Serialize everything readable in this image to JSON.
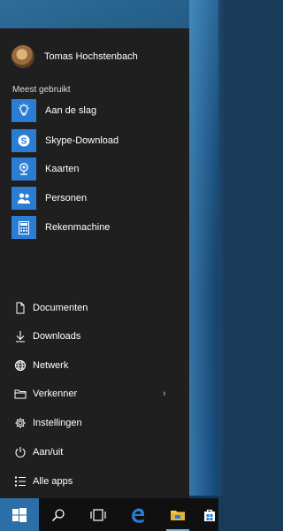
{
  "user": {
    "name": "Tomas Hochstenbach"
  },
  "most_used": {
    "heading": "Meest gebruikt",
    "apps": [
      {
        "label": "Aan de slag",
        "icon": "lightbulb-icon"
      },
      {
        "label": "Skype-Download",
        "icon": "skype-icon"
      },
      {
        "label": "Kaarten",
        "icon": "map-pin-icon"
      },
      {
        "label": "Personen",
        "icon": "people-icon"
      },
      {
        "label": "Rekenmachine",
        "icon": "calculator-icon"
      }
    ]
  },
  "system": [
    {
      "label": "Documenten",
      "icon": "document-icon"
    },
    {
      "label": "Downloads",
      "icon": "download-icon"
    },
    {
      "label": "Netwerk",
      "icon": "network-icon"
    },
    {
      "label": "Verkenner",
      "icon": "folder-icon",
      "has_submenu": true
    },
    {
      "label": "Instellingen",
      "icon": "gear-icon"
    },
    {
      "label": "Aan/uit",
      "icon": "power-icon"
    },
    {
      "label": "Alle apps",
      "icon": "list-icon"
    }
  ],
  "colors": {
    "accent": "#2b7cd3",
    "menu_bg": "#1f1f1f",
    "taskbar_bg": "#101010"
  },
  "taskbar": {
    "items": [
      "windows-logo-icon",
      "search-icon",
      "task-view-icon",
      "edge-icon",
      "file-explorer-icon",
      "store-icon"
    ]
  }
}
